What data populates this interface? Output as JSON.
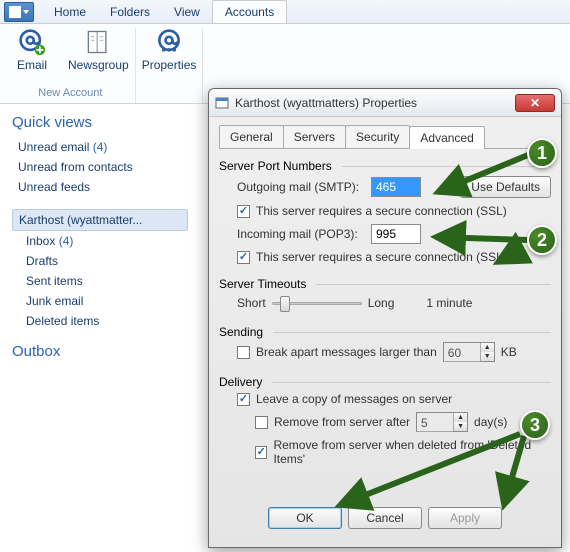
{
  "ribbon": {
    "tabs": [
      "Home",
      "Folders",
      "View",
      "Accounts"
    ],
    "active_tab": "Accounts",
    "buttons": {
      "email": "Email",
      "newsgroup": "Newsgroup",
      "properties": "Properties"
    },
    "group_label": "New Account"
  },
  "sidebar": {
    "quick_views": "Quick views",
    "items": [
      "Unread email",
      "Unread from contacts",
      "Unread feeds"
    ],
    "unread_email_count": "(4)",
    "account": "Karthost (wyattmatter...",
    "folders": [
      "Inbox",
      "Drafts",
      "Sent items",
      "Junk email",
      "Deleted items"
    ],
    "inbox_count": "(4)",
    "outbox": "Outbox"
  },
  "dialog": {
    "title": "Karthost (wyattmatters) Properties",
    "tabs": [
      "General",
      "Servers",
      "Security",
      "Advanced"
    ],
    "active_tab": "Advanced",
    "sections": {
      "ports": "Server Port Numbers",
      "timeouts": "Server Timeouts",
      "sending": "Sending",
      "delivery": "Delivery"
    },
    "labels": {
      "smtp": "Outgoing mail (SMTP):",
      "pop3": "Incoming mail (POP3):",
      "ssl": "This server requires a secure connection (SSL)",
      "use_defaults": "Use Defaults",
      "short": "Short",
      "long": "Long",
      "timeout_value": "1 minute",
      "break": "Break apart messages larger than",
      "kb": "KB",
      "leave": "Leave a copy of messages on server",
      "remove_after": "Remove from server after",
      "days": "day(s)",
      "remove_deleted": "Remove from server when deleted from 'Deleted Items'"
    },
    "values": {
      "smtp": "465",
      "pop3": "995",
      "break_kb": "60",
      "remove_days": "5"
    },
    "buttons": {
      "ok": "OK",
      "cancel": "Cancel",
      "apply": "Apply"
    }
  },
  "callouts": {
    "c1": "1",
    "c2": "2",
    "c3": "3"
  },
  "chart_data": null
}
